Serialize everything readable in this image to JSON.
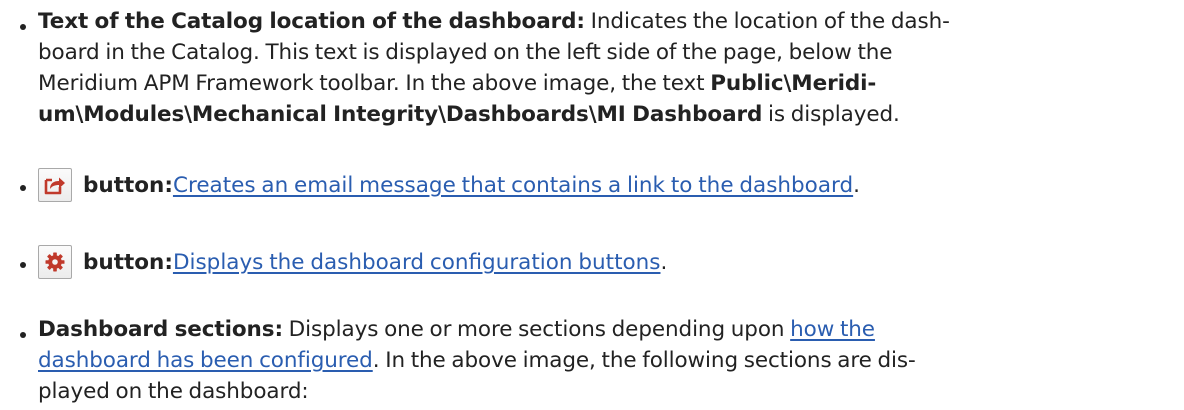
{
  "items": [
    {
      "label": "Text of the Catalog location of the dashboard:",
      "line1": " Indicates the location of the dash-",
      "line2": "board in the Catalog. This text is displayed on the left side of the page, below the",
      "line3_pre": "Meridium APM Framework toolbar. In the above image, the text ",
      "line3_bold": "Public\\Meridi-",
      "line4_bold": "um\\Modules\\Mechanical Integrity\\Dashboards\\MI Dashboard",
      "line4_post": " is displayed."
    },
    {
      "icon": "send-link-icon",
      "label": "button:",
      "link": "Creates an email message that contains a link to the dashboard",
      "post": "."
    },
    {
      "icon": "gear-icon",
      "label": "button:",
      "link": "Displays the dashboard configuration buttons",
      "post": "."
    },
    {
      "label": "Dashboard sections:",
      "line1_pre": " Displays one or more sections depending upon ",
      "link_part1": "how the",
      "link_part2": "dashboard has been configured",
      "line2_post": ". In the above image, the following sections are dis-",
      "line3": "played on the dashboard:"
    }
  ],
  "colors": {
    "text": "#222222",
    "link": "#2a5db0",
    "icon_red": "#c0392b"
  }
}
